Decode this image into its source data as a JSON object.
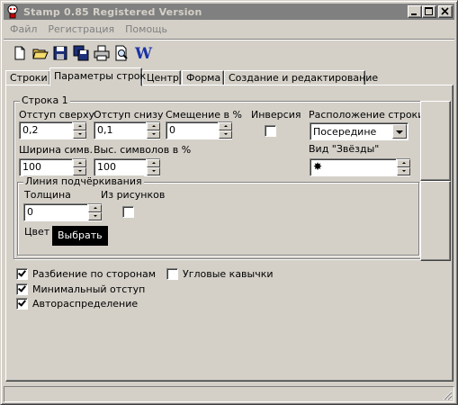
{
  "window": {
    "title": "Stamp 0.85 Registered Version"
  },
  "menu": [
    "Файл",
    "Регистрация",
    "Помощь"
  ],
  "toolbar": {
    "tools": [
      "new-document-icon",
      "open-folder-icon",
      "save-icon",
      "save-as-icon",
      "print-icon",
      "print-preview-icon",
      "word-export-icon"
    ],
    "word_label": "W"
  },
  "tabs": [
    "Строки",
    "Параметры строк",
    "Центр",
    "Форма",
    "Создание и редактирование"
  ],
  "active_tab": "Параметры строк",
  "line1": {
    "legend": "Строка 1",
    "top_offset": {
      "label": "Отступ сверху",
      "value": "0,2"
    },
    "bottom_offset": {
      "label": "Отступ снизу",
      "value": "0,1"
    },
    "shift": {
      "label": "Смещение в %",
      "value": "0"
    },
    "inversion": {
      "label": "Инверсия",
      "checked": false
    },
    "position": {
      "label": "Расположение строки",
      "value": "Посередине"
    },
    "char_width": {
      "label": "Ширина симв.",
      "value": "100"
    },
    "char_height": {
      "label": "Выс. символов в %",
      "value": "100"
    },
    "star_type": {
      "label": "Вид \"Звёзды\"",
      "value": "✸"
    }
  },
  "underline": {
    "legend": "Линия подчёркивания",
    "thickness": {
      "label": "Толщина",
      "value": "0"
    },
    "from_picture": {
      "label": "Из рисунков",
      "checked": false
    },
    "color_label": "Цвет",
    "choose_label": "Выбрать"
  },
  "options": {
    "split_sides": {
      "label": "Разбиение по сторонам",
      "checked": true
    },
    "min_indent": {
      "label": "Минимальный отступ",
      "checked": true
    },
    "auto_distribution": {
      "label": "Автораспределение",
      "checked": true
    },
    "angle_quotes": {
      "label": "Угловые кавычки",
      "checked": false
    }
  },
  "colors": {
    "face": "#d4d0c8",
    "title_inactive": "#808080",
    "word_blue": "#1a33a6"
  }
}
